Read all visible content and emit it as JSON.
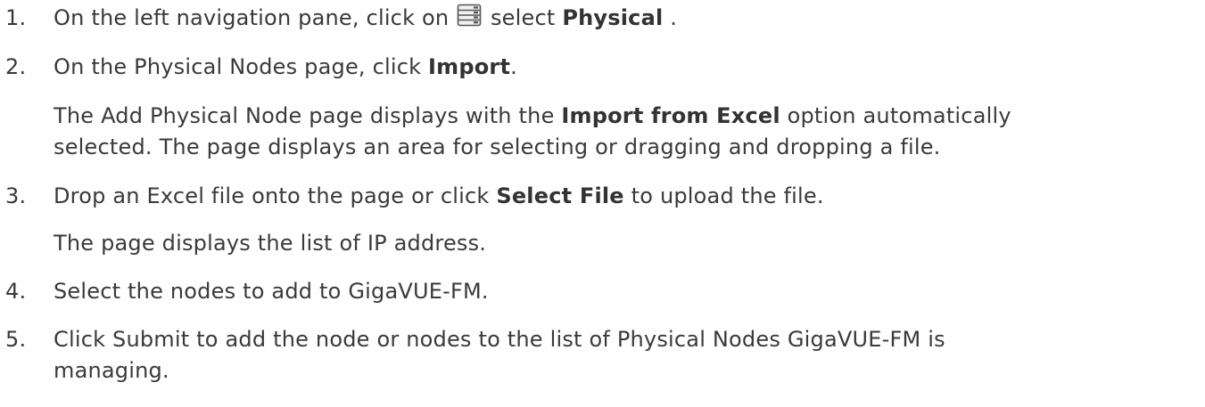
{
  "steps": [
    {
      "number": "1.",
      "parts": [
        "On the left navigation pane, click on ",
        " select ",
        "Physical",
        " ."
      ],
      "icon": "server-list-icon"
    },
    {
      "number": "2.",
      "parts": [
        "On the Physical Nodes page, click ",
        "Import",
        "."
      ]
    },
    {
      "note_lines": [
        [
          "The Add Physical Node page displays with the ",
          "Import from Excel",
          " option automatically"
        ],
        [
          "selected. The page displays an area for selecting or dragging and dropping a file."
        ]
      ]
    },
    {
      "number": "3.",
      "parts": [
        "Drop an Excel file onto the page or click ",
        "Select File",
        " to upload the file."
      ]
    },
    {
      "note": "The page displays the list of IP address."
    },
    {
      "number": "4.",
      "text": "Select the nodes to add to GigaVUE-FM."
    },
    {
      "number": "5.",
      "lines": [
        "Click Submit to add the node or nodes to the list of Physical Nodes GigaVUE-FM is",
        "managing."
      ]
    }
  ],
  "colors": {
    "text": "#3a3a3a",
    "icon_stroke": "#555555",
    "icon_fill": "#f2f2f2"
  }
}
